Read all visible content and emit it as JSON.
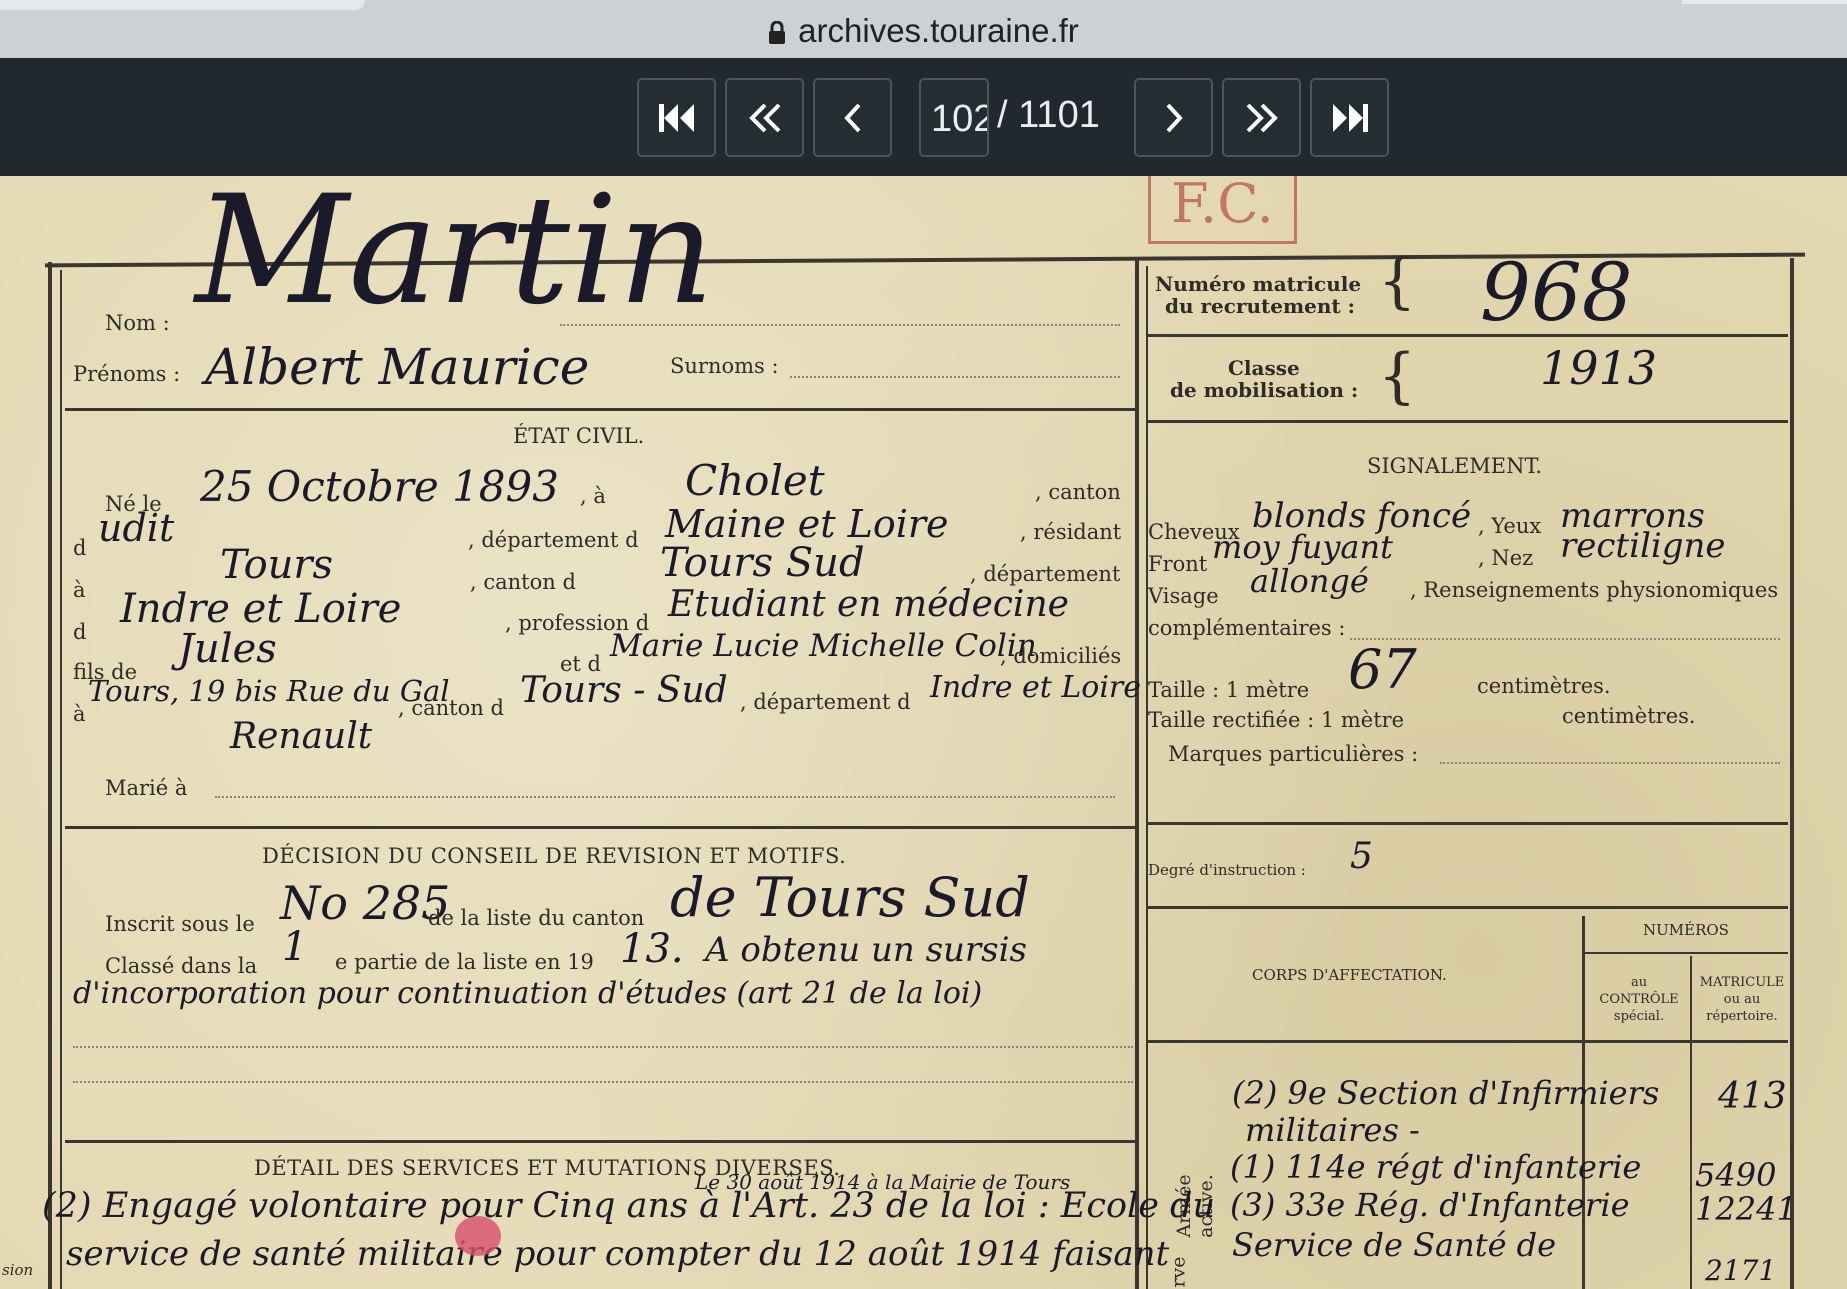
{
  "browser": {
    "url": "archives.touraine.fr"
  },
  "viewer": {
    "current_page": "102",
    "total_pages": "/ 1101",
    "buttons": [
      "first-page",
      "previous-10",
      "previous-page",
      "next-page",
      "next-10",
      "last-page"
    ]
  },
  "stamp": "F.C.",
  "header": {
    "nom_label": "Nom :",
    "nom_value": "Martin",
    "prenoms_label": "Prénoms :",
    "prenoms_value": "Albert Maurice",
    "surnoms_label": "Surnoms :",
    "matricule_label_1": "Numéro matricule",
    "matricule_label_2": "du recrutement :",
    "matricule_value": "968",
    "classe_label_1": "Classe",
    "classe_label_2": "de mobilisation :",
    "classe_value": "1913"
  },
  "etat_civil": {
    "title": "ÉTAT CIVIL.",
    "ne_le_label": "Né le",
    "ne_le_value": "25 Octobre 1893",
    "a_label": ", à",
    "a_value": "Cholet",
    "canton_label": ", canton",
    "d1_label": "d",
    "d1_value": "udit",
    "dept_label": ", département d",
    "dept_value": "Maine et Loire",
    "residant_label": ", résidant",
    "a2_label": "à",
    "a2_value": "Tours",
    "canton2_label": ", canton d",
    "canton2_value": "Tours Sud",
    "dept2_label": ", département",
    "d3_label": "d",
    "d3_value": "Indre et Loire",
    "profession_label": ", profession d",
    "profession_value": "Etudiant en médecine",
    "fils_label": "fils de",
    "fils_value": "Jules",
    "et_label": "et d",
    "mere_value": "Marie Lucie Michelle Colin",
    "domicilies_label": ", domiciliés",
    "a3_label": "à",
    "a3_value": "Tours, 19 bis Rue du Gal",
    "a3_value_2": "Renault",
    "canton3_label": ", canton d",
    "canton3_value": "Tours - Sud",
    "dept3_label": ", département d",
    "dept3_value": "Indre et Loire",
    "marie_label": "Marié à"
  },
  "signalement": {
    "title": "SIGNALEMENT.",
    "cheveux_label": "Cheveux",
    "cheveux_value": "blonds foncé",
    "yeux_label": ", Yeux",
    "yeux_value": "marrons",
    "front_label": "Front",
    "front_value": "moy fuyant",
    "nez_label": ", Nez",
    "nez_value": "rectiligne",
    "visage_label": "Visage",
    "visage_value": "allongé",
    "renseignements_label": ", Renseignements physionomiques",
    "complementaires_label": "complémentaires :",
    "taille_label": "Taille : 1 mètre",
    "taille_value": "67",
    "taille_unit": "centimètres.",
    "taille_rect_label": "Taille rectifiée : 1 mètre",
    "taille_rect_unit": "centimètres.",
    "marques_label": "Marques particulières :",
    "degre_label": "Degré d'instruction :",
    "degre_value": "5"
  },
  "decision": {
    "title": "DÉCISION DU CONSEIL DE REVISION ET MOTIFS.",
    "inscrit_label": "Inscrit sous le",
    "inscrit_value": "No 285",
    "liste_label": "de la liste du canton",
    "liste_value": "de Tours Sud",
    "classe_label": "Classé dans la",
    "classe_value": "1",
    "partie_label": "e partie de la liste en 19",
    "annee_value": "13.",
    "obtenu_value": "A obtenu un sursis",
    "motif_value": "d'incorporation pour continuation d'études (art 21 de la loi)"
  },
  "affectation": {
    "numeros_title": "NUMÉROS",
    "corps_title": "CORPS D'AFFECTATION.",
    "controle_label": "au CONTRÔLE spécial.",
    "matricule_label": "MATRICULE ou au répertoire.",
    "armee_active_label": "Armée active.",
    "reserve_label": "rve",
    "line1": "(2) 9e Section d'Infirmiers",
    "line2": "militaires -",
    "line3": "(1) 114e régt d'infanterie",
    "line4": "(3) 33e Rég. d'Infanterie",
    "line5": "Service de Santé de",
    "num1": "413",
    "num2": "5490",
    "num3": "12241",
    "num4": "2171"
  },
  "services": {
    "title": "DÉTAIL DES SERVICES ET MUTATIONS DIVERSES.",
    "note_top": "Le 30 août 1914 à la Mairie de Tours",
    "line1": "(2) Engagé volontaire pour Cinq ans à l'Art. 23 de la loi : Ecole du",
    "line2": "service de santé militaire pour compter du 12 août 1914 faisant",
    "margin_note": "sion"
  }
}
